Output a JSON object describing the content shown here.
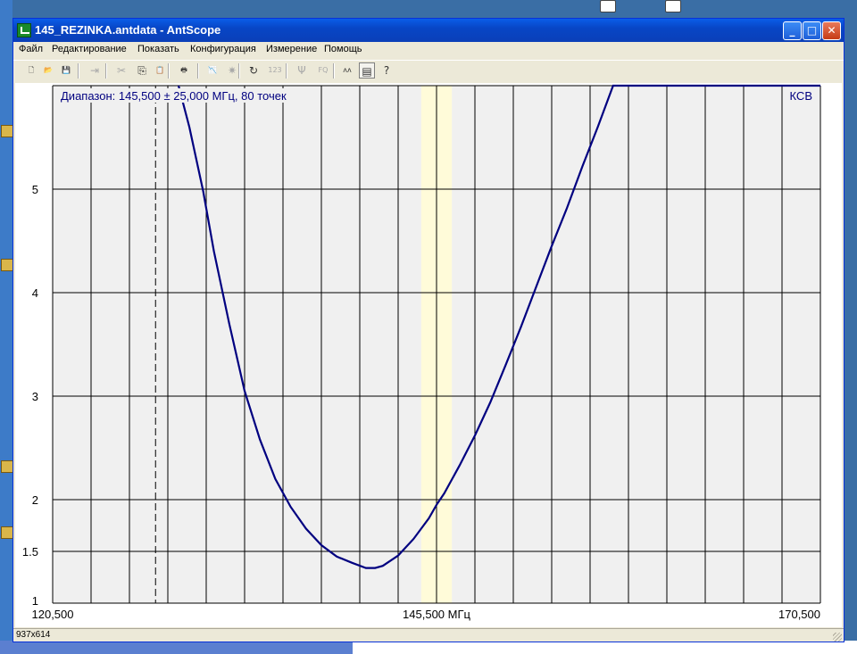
{
  "window": {
    "title": "145_REZINKA.antdata - AntScope"
  },
  "menu": [
    "Файл",
    "Редактирование",
    "Показать",
    "Конфигурация",
    "Измерение",
    "Помощь"
  ],
  "toolbar": [
    {
      "name": "new-file-icon",
      "glyph": "🗋",
      "enabled": true
    },
    {
      "name": "open-file-icon",
      "glyph": "📂",
      "enabled": true
    },
    {
      "name": "save-icon",
      "glyph": "💾",
      "enabled": true
    },
    {
      "name": "export-icon",
      "glyph": "⇥",
      "enabled": false
    },
    {
      "name": "cut-icon",
      "glyph": "✂",
      "enabled": false
    },
    {
      "name": "copy-icon",
      "glyph": "⎘",
      "enabled": true
    },
    {
      "name": "paste-icon",
      "glyph": "📋",
      "enabled": false
    },
    {
      "name": "print-icon",
      "glyph": "🖶",
      "enabled": true
    },
    {
      "name": "chart-icon",
      "glyph": "📉",
      "enabled": false
    },
    {
      "name": "star-icon",
      "glyph": "✷",
      "enabled": false
    },
    {
      "name": "refresh-icon",
      "glyph": "↻",
      "enabled": true
    },
    {
      "name": "numbers-icon",
      "glyph": "123",
      "enabled": false
    },
    {
      "name": "antenna-icon",
      "glyph": "Ψ",
      "enabled": false
    },
    {
      "name": "fq-icon",
      "glyph": "FQ",
      "enabled": false
    },
    {
      "name": "graph-mode-icon",
      "glyph": "ʌʌ",
      "enabled": true
    },
    {
      "name": "table-mode-icon",
      "glyph": "▤",
      "enabled": true
    },
    {
      "name": "help-icon",
      "glyph": "?",
      "enabled": true
    }
  ],
  "plot": {
    "range_label": "Диапазон: 145,500 ± 25,000 МГц, 80 точек",
    "param_label": "КСВ",
    "x_left_label": "120,500",
    "x_center_label": "145,500 МГц",
    "x_right_label": "170,500",
    "y_tick_labels": [
      "5",
      "4",
      "3",
      "2",
      "1.5",
      "1"
    ]
  },
  "status": {
    "text": "937x614"
  },
  "chart_data": {
    "type": "line",
    "title": "Диапазон: 145,500 ± 25,000 МГц, 80 точек",
    "xlabel": "МГц",
    "ylabel": "КСВ",
    "xlim": [
      120.5,
      170.5
    ],
    "ylim": [
      1,
      6
    ],
    "y_ticks": [
      1,
      1.5,
      2,
      3,
      4,
      5
    ],
    "x_ticks_labeled": [
      120.5,
      145.5,
      170.5
    ],
    "grid": true,
    "line_color": "#000080",
    "marker_x": 127.2,
    "highlight_band": [
      144.5,
      146.5
    ],
    "highlight_color": "#fffbd9",
    "series": [
      {
        "name": "КСВ",
        "x": [
          128.7,
          129.4,
          130.3,
          131.0,
          132.0,
          133.0,
          134.0,
          135.0,
          136.0,
          137.0,
          138.0,
          139.0,
          140.0,
          140.9,
          141.5,
          142.0,
          143.0,
          144.0,
          145.0,
          145.5,
          146.0,
          147.0,
          148.0,
          149.0,
          150.0,
          151.0,
          152.0,
          153.0,
          154.0,
          155.0,
          156.0,
          157.0,
          158.0,
          158.5,
          159.5,
          160.0
        ],
        "y": [
          6.0,
          5.6,
          4.98,
          4.4,
          3.7,
          3.05,
          2.58,
          2.2,
          1.93,
          1.72,
          1.56,
          1.45,
          1.39,
          1.34,
          1.34,
          1.36,
          1.46,
          1.62,
          1.82,
          1.95,
          2.06,
          2.33,
          2.62,
          2.94,
          3.3,
          3.67,
          4.06,
          4.45,
          4.82,
          5.22,
          5.6,
          6.0,
          6.0,
          6.0,
          6.0,
          6.0
        ]
      }
    ]
  }
}
